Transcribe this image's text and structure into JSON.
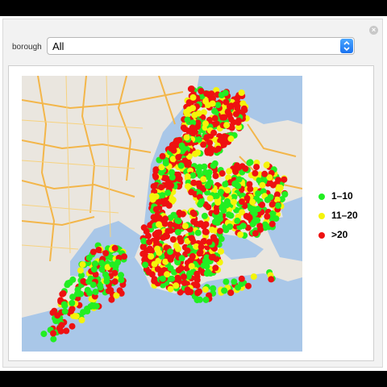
{
  "controls": {
    "borough_label": "borough",
    "borough_value": "All"
  },
  "legend": [
    {
      "label": "1–10",
      "color": "#22ee22"
    },
    {
      "label": "11–20",
      "color": "#f4f40a"
    },
    {
      "label": ">20",
      "color": "#ee1111"
    }
  ],
  "map": {
    "description_icon": "map-icon",
    "water_color": "#a9c7e8",
    "land_color": "#eae6df",
    "road_color": "#f3b64a"
  }
}
